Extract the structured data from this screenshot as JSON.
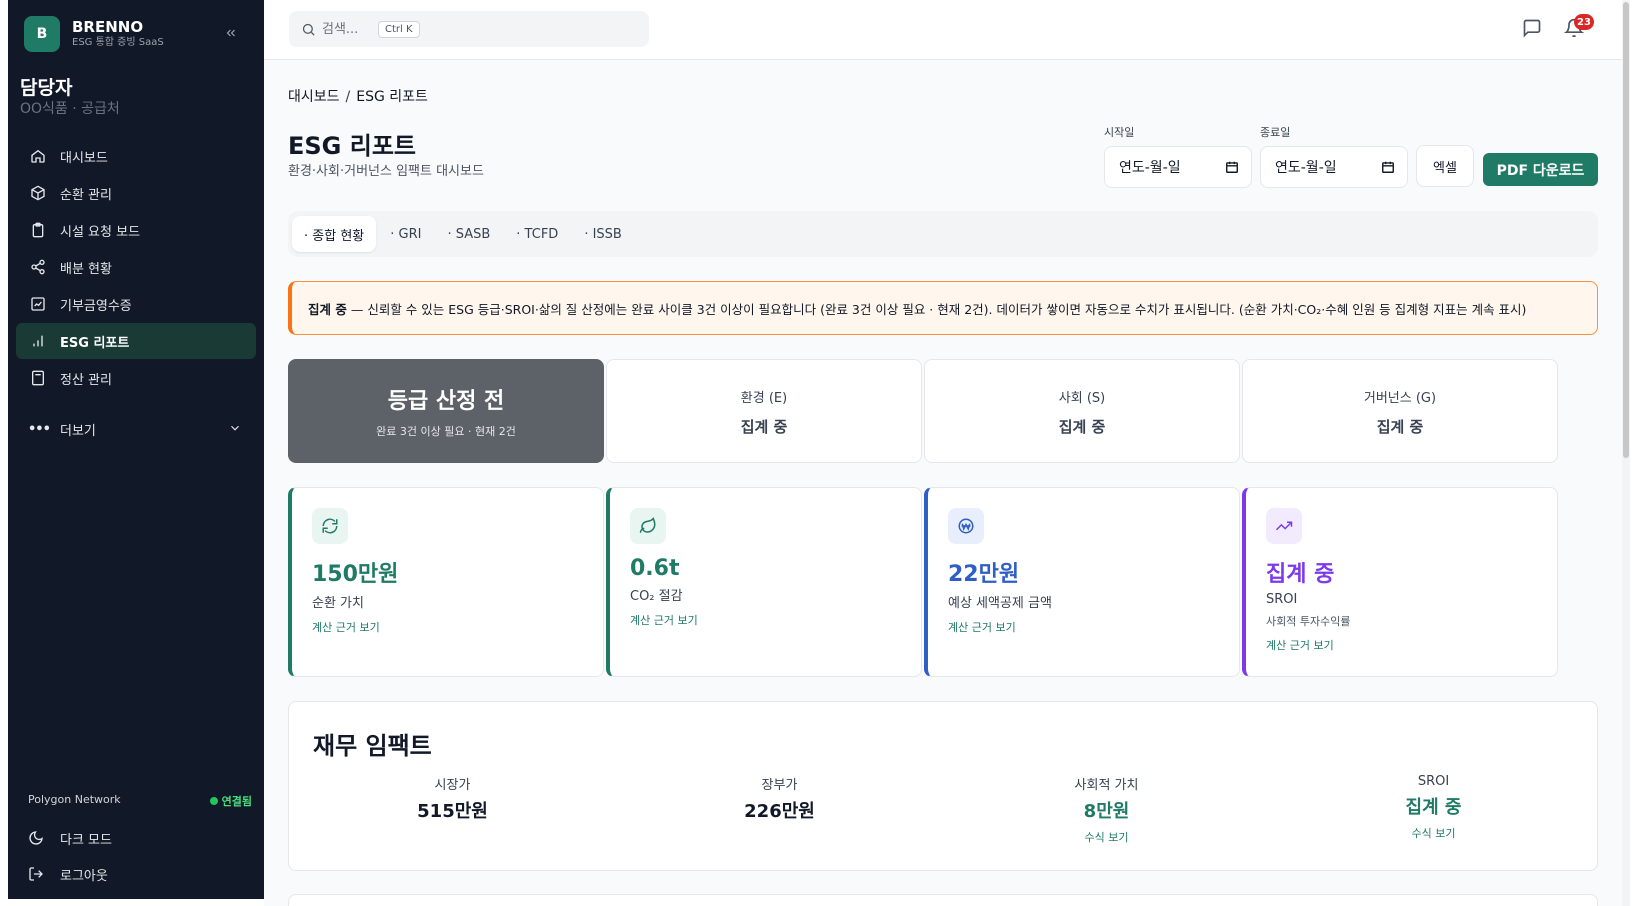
{
  "brand": {
    "logo_letter": "B",
    "name": "BRENNO",
    "subtitle": "ESG 통합 증빙 SaaS"
  },
  "role": {
    "title": "담당자",
    "org": "OO식품 · 공급처"
  },
  "sidebar": {
    "items": [
      {
        "label": "대시보드",
        "icon": "home-icon"
      },
      {
        "label": "순환 관리",
        "icon": "box-icon"
      },
      {
        "label": "시설 요청 보드",
        "icon": "clipboard-icon"
      },
      {
        "label": "배분 현황",
        "icon": "share-icon"
      },
      {
        "label": "기부금영수증",
        "icon": "receipt-icon"
      },
      {
        "label": "ESG 리포트",
        "icon": "bar-chart-icon",
        "active": true
      },
      {
        "label": "정산 관리",
        "icon": "calculator-icon"
      }
    ],
    "more_label": "더보기",
    "network_name": "Polygon Network",
    "network_status": "연결됨",
    "dark_mode_label": "다크 모드",
    "logout_label": "로그아웃"
  },
  "topbar": {
    "search_placeholder": "검색...",
    "search_shortcut": "Ctrl K",
    "notification_count": "23"
  },
  "breadcrumb": {
    "parent": "대시보드",
    "separator": "/",
    "current": "ESG 리포트"
  },
  "header": {
    "title": "ESG 리포트",
    "subtitle": "환경·사회·거버넌스 임팩트 대시보드",
    "start_label": "시작일",
    "start_value": "연도-월-일",
    "end_label": "종료일",
    "end_value": "연도-월-일",
    "excel_label": "엑셀",
    "pdf_label": "PDF 다운로드"
  },
  "tabs": [
    "· 종합 현황",
    "· GRI",
    "· SASB",
    "· TCFD",
    "· ISSB"
  ],
  "notice": {
    "bold": "집계 중",
    "text": "— 신뢰할 수 있는 ESG 등급·SROI·삶의 질 산정에는 완료 사이클 3건 이상이 필요합니다 (완료 3건 이상 필요 · 현재 2건). 데이터가 쌓이면 자동으로 수치가 표시됩니다. (순환 가치·CO₂·수혜 인원 등 집계형 지표는 계속 표시)"
  },
  "grade": {
    "title": "등급 산정 전",
    "subtitle": "완료 3건 이상 필요 · 현재 2건"
  },
  "pillars": [
    {
      "label": "환경 (E)",
      "value": "집계 중"
    },
    {
      "label": "사회 (S)",
      "value": "집계 중"
    },
    {
      "label": "거버넌스 (G)",
      "value": "집계 중"
    }
  ],
  "kpis": [
    {
      "value": "150만원",
      "label": "순환 가치",
      "link": "계산 근거 보기",
      "color": "#1f7a66",
      "bg": "#e8f5f0",
      "icon": "refresh-icon"
    },
    {
      "value": "0.6t",
      "label": "CO₂ 절감",
      "link": "계산 근거 보기",
      "color": "#1f7a66",
      "bg": "#e8f5f0",
      "icon": "leaf-icon"
    },
    {
      "value": "22만원",
      "label": "예상 세액공제 금액",
      "link": "계산 근거 보기",
      "color": "#2f5fc4",
      "bg": "#e8eefb",
      "icon": "won-icon"
    },
    {
      "value": "집계 중",
      "label": "SROI",
      "desc": "사회적 투자수익률",
      "link": "계산 근거 보기",
      "color": "#7c3aed",
      "bg": "#f1ebfd",
      "icon": "trending-up-icon"
    }
  ],
  "financial": {
    "title": "재무 임팩트",
    "items": [
      {
        "label": "시장가",
        "value": "515만원"
      },
      {
        "label": "장부가",
        "value": "226만원"
      },
      {
        "label": "사회적 가치",
        "value": "8만원",
        "link": "수식 보기",
        "accent": "#1f7a66"
      },
      {
        "label": "SROI",
        "value": "집계 중",
        "link": "수식 보기",
        "accent": "#1f7a66"
      }
    ]
  }
}
